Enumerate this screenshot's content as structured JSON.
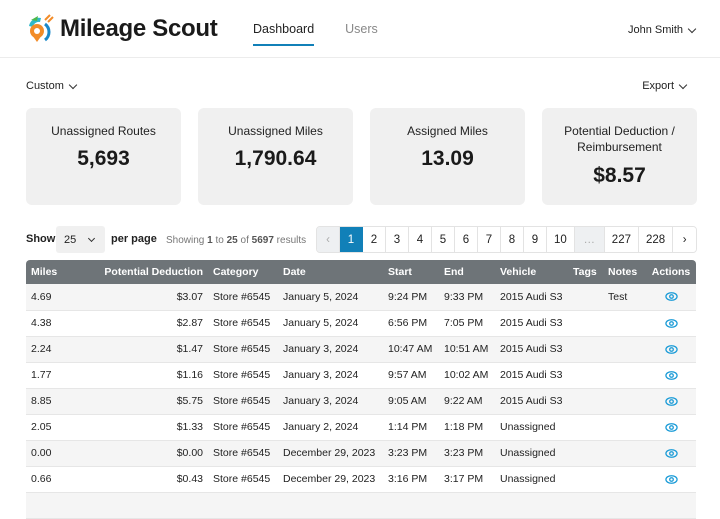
{
  "app": {
    "name": "Mileage Scout",
    "logo_icon": "location-pin-icon"
  },
  "nav": {
    "items": [
      {
        "label": "Dashboard",
        "active": true
      },
      {
        "label": "Users",
        "active": false
      }
    ]
  },
  "user": {
    "name": "John Smith",
    "icon": "chevron-down-icon"
  },
  "filters": {
    "range_label": "Custom",
    "export_label": "Export"
  },
  "cards": [
    {
      "title": "Unassigned Routes",
      "value": "5,693"
    },
    {
      "title": "Unassigned Miles",
      "value": "1,790.64"
    },
    {
      "title": "Assigned Miles",
      "value": "13.09"
    },
    {
      "title": "Potential Deduction / Reimbursement",
      "value": "$8.57"
    }
  ],
  "controls": {
    "show_label": "Show",
    "per_page_value": "25",
    "per_page_label": "per page",
    "results_prefix": "Showing",
    "results_from": "1",
    "results_to_word": "to",
    "results_to": "25",
    "results_of_word": "of",
    "results_total": "5697",
    "results_suffix": "results"
  },
  "pagination": {
    "prev": "‹",
    "next": "›",
    "current": "1",
    "pages": [
      "1",
      "2",
      "3",
      "4",
      "5",
      "6",
      "7",
      "8",
      "9",
      "10",
      "…",
      "227",
      "228"
    ]
  },
  "table": {
    "columns": [
      "Miles",
      "Potential Deduction",
      "Category",
      "Date",
      "Start",
      "End",
      "Vehicle",
      "Tags",
      "Notes",
      "Actions"
    ],
    "rows": [
      {
        "miles": "4.69",
        "deduction": "$3.07",
        "category": "Store #6545",
        "date": "January 5, 2024",
        "start": "9:24 PM",
        "end": "9:33 PM",
        "vehicle": "2015 Audi S3",
        "tags": "",
        "notes": "Test"
      },
      {
        "miles": "4.38",
        "deduction": "$2.87",
        "category": "Store #6545",
        "date": "January 5, 2024",
        "start": "6:56 PM",
        "end": "7:05 PM",
        "vehicle": "2015 Audi S3",
        "tags": "",
        "notes": ""
      },
      {
        "miles": "2.24",
        "deduction": "$1.47",
        "category": "Store #6545",
        "date": "January 3, 2024",
        "start": "10:47 AM",
        "end": "10:51 AM",
        "vehicle": "2015 Audi S3",
        "tags": "",
        "notes": ""
      },
      {
        "miles": "1.77",
        "deduction": "$1.16",
        "category": "Store #6545",
        "date": "January 3, 2024",
        "start": "9:57 AM",
        "end": "10:02 AM",
        "vehicle": "2015 Audi S3",
        "tags": "",
        "notes": ""
      },
      {
        "miles": "8.85",
        "deduction": "$5.75",
        "category": "Store #6545",
        "date": "January 3, 2024",
        "start": "9:05 AM",
        "end": "9:22 AM",
        "vehicle": "2015 Audi S3",
        "tags": "",
        "notes": ""
      },
      {
        "miles": "2.05",
        "deduction": "$1.33",
        "category": "Store #6545",
        "date": "January 2, 2024",
        "start": "1:14 PM",
        "end": "1:18 PM",
        "vehicle": "Unassigned",
        "tags": "",
        "notes": ""
      },
      {
        "miles": "0.00",
        "deduction": "$0.00",
        "category": "Store #6545",
        "date": "December 29, 2023",
        "start": "3:23 PM",
        "end": "3:23 PM",
        "vehicle": "Unassigned",
        "tags": "",
        "notes": ""
      },
      {
        "miles": "0.66",
        "deduction": "$0.43",
        "category": "Store #6545",
        "date": "December 29, 2023",
        "start": "3:16 PM",
        "end": "3:17 PM",
        "vehicle": "Unassigned",
        "tags": "",
        "notes": ""
      },
      {
        "miles": "",
        "deduction": "",
        "category": "",
        "date": "",
        "start": "",
        "end": "",
        "vehicle": "",
        "tags": "",
        "notes": ""
      }
    ],
    "action_icon": "eye-icon"
  },
  "colors": {
    "accent": "#1180b8",
    "header_bg": "#6e7478",
    "card_bg": "#f0f0f0"
  }
}
